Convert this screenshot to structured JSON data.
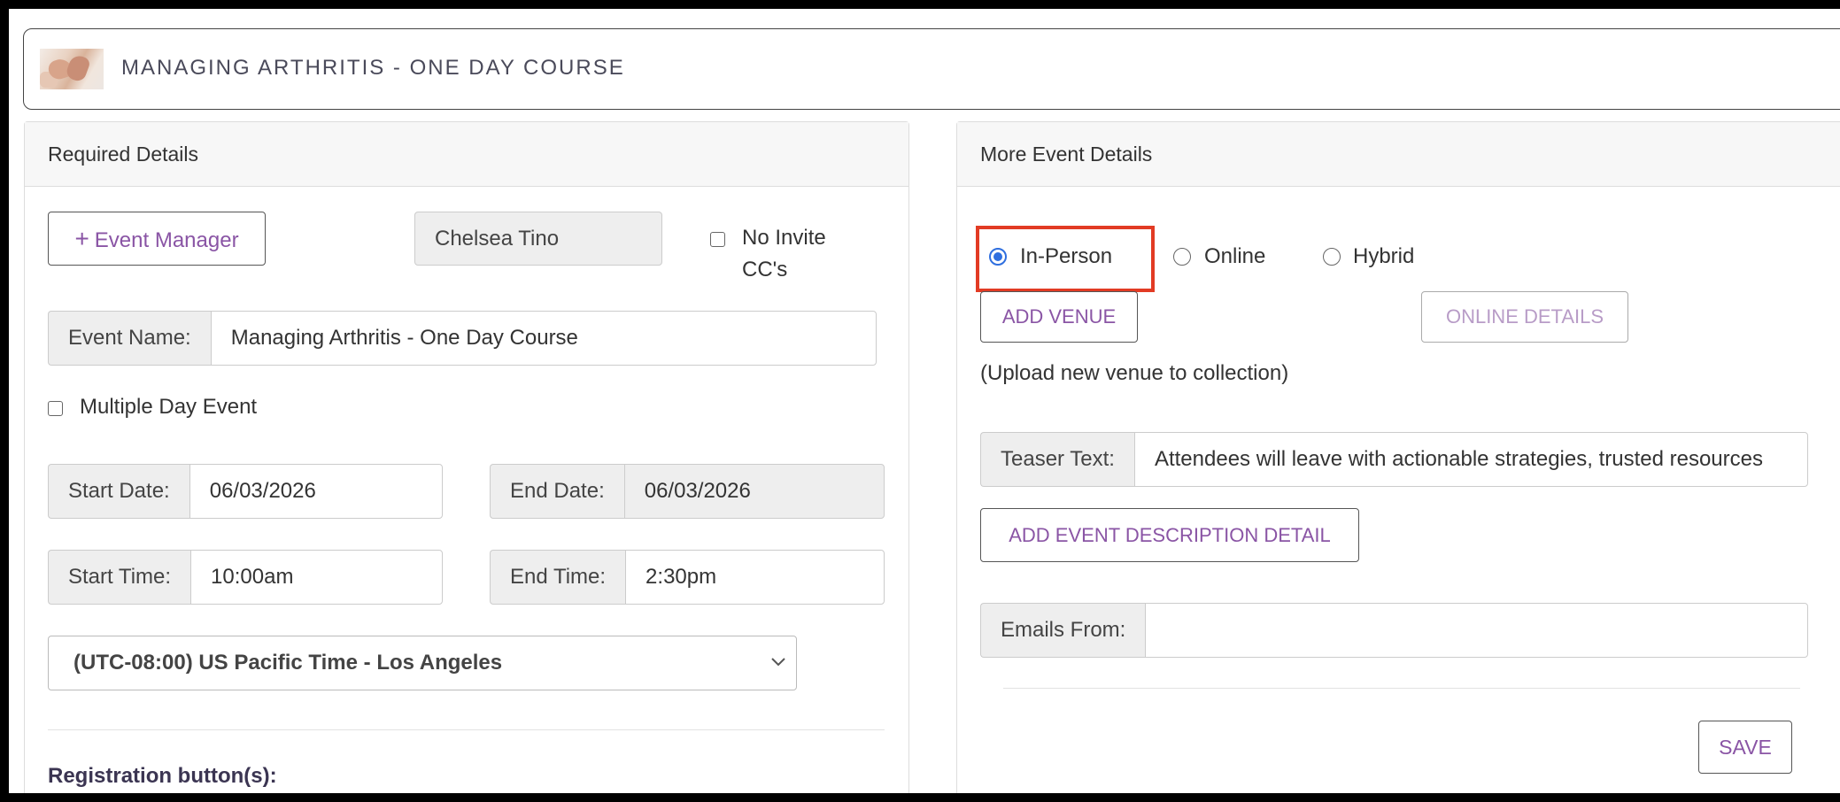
{
  "header": {
    "title": "MANAGING ARTHRITIS - ONE DAY COURSE",
    "thumbnail_icon": "hands-thumbnail-image"
  },
  "required": {
    "heading": "Required Details",
    "event_manager_button": "Event Manager",
    "plus_glyph": "+",
    "manager_name": "Chelsea Tino",
    "no_invite_cc_line1": "No Invite",
    "no_invite_cc_line2": "CC's",
    "event_name_label": "Event Name:",
    "event_name_value": "Managing Arthritis - One Day Course",
    "multiple_day_label": "Multiple Day Event",
    "start_date_label": "Start Date:",
    "start_date_value": "06/03/2026",
    "end_date_label": "End Date:",
    "end_date_value": "06/03/2026",
    "start_time_label": "Start Time:",
    "start_time_value": "10:00am",
    "end_time_label": "End Time:",
    "end_time_value": "2:30pm",
    "timezone_selected": "(UTC-08:00) US Pacific Time - Los Angeles",
    "registration_heading": "Registration button(s):"
  },
  "more": {
    "heading": "More Event Details",
    "attendance_options": [
      "In-Person",
      "Online",
      "Hybrid"
    ],
    "attendance_selected": "In-Person",
    "add_venue_button": "ADD VENUE",
    "online_details_button": "ONLINE DETAILS",
    "upload_venue_link": "(Upload new venue to collection)",
    "teaser_label": "Teaser Text:",
    "teaser_value": "Attendees will leave with actionable strategies, trusted resources",
    "add_description_button": "ADD EVENT DESCRIPTION DETAIL",
    "emails_from_label": "Emails From:",
    "emails_from_value": "",
    "save_button": "SAVE"
  },
  "colors": {
    "accent_purple": "#8a55a5",
    "radio_blue": "#2f6fdf",
    "highlight_red": "#e23b24"
  }
}
